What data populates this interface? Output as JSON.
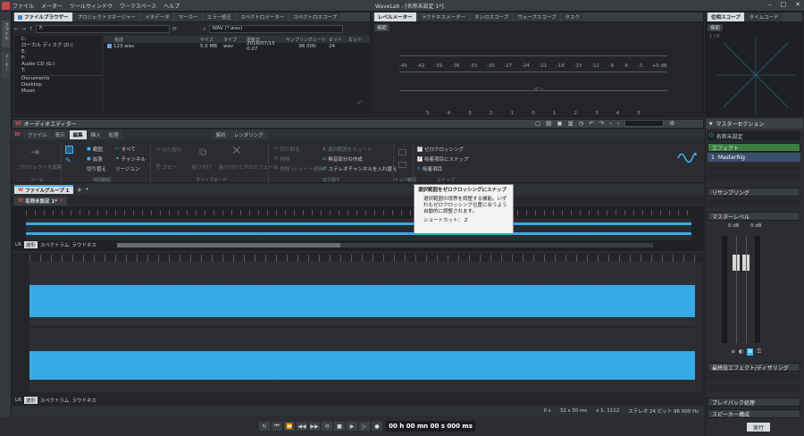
{
  "window": {
    "title": "WaveLab - [名称未設定 1*]"
  },
  "menu": [
    "ファイル",
    "メーター",
    "ツールウィンドウ",
    "ワークスペース",
    "ヘルプ"
  ],
  "left_strip": [
    "ファイル",
    "メーター"
  ],
  "upper_tabs": [
    "ファイルブラウザー",
    "プロジェクトマネージャー",
    "メタデータ",
    "マーカー",
    "エラー修正",
    "スペクトロメーター",
    "スペクトロスコープ"
  ],
  "browser": {
    "path": "F:",
    "filter": "WAV (*.wav)",
    "tree": [
      "C:",
      "ローカル ディスク (D:)",
      "E:",
      "F:",
      "Audio CD (G:)",
      "T:",
      "Documents",
      "Desktop",
      "Music"
    ],
    "columns": [
      "名前",
      "サイズ",
      "タイプ",
      "更新日",
      "サンプリングレート",
      "ビット",
      "ビット"
    ],
    "files": [
      {
        "name": "123.wav",
        "size": "5.0 MB",
        "type": "wav",
        "date": "2016/07/15 0:27",
        "rate": "96 000",
        "bits": "24"
      }
    ]
  },
  "meter_tabs": [
    "レベルメーター",
    "ラウドネスメーター",
    "オシロスコープ",
    "ウェーブスコープ",
    "タスク"
  ],
  "meter": {
    "mode": "模範",
    "scale": [
      "-45",
      "-42",
      "-39",
      "-36",
      "-33",
      "-30",
      "-27",
      "-24",
      "-21",
      "-18",
      "-15",
      "-12",
      "-9",
      "-6",
      "-3",
      "+0 dB"
    ],
    "pan_label": "パン",
    "pan_scale": [
      "5",
      "4",
      "3",
      "2",
      "1",
      "0",
      "1",
      "2",
      "3",
      "4",
      "5"
    ]
  },
  "phase_tabs": [
    "位相スコープ",
    "タイムコード"
  ],
  "phase": {
    "mode": "模範",
    "top_left": "1 / 0"
  },
  "audio_editor": {
    "title": "オーディオエディター",
    "tabs": [
      "ファイル",
      "表示",
      "編集",
      "挿入",
      "処理",
      "解析",
      "レンダリング"
    ],
    "active_tab": "編集"
  },
  "ribbon": {
    "sections": [
      "ツール",
      "時間範囲",
      "クリップボード",
      "切り取り",
      "ナッジ範囲",
      "スナップ"
    ],
    "tool_item": "プロジェクトを編集",
    "time_range": [
      "範囲",
      "すべて",
      "拡張",
      "チャンネル",
      "切り替え",
      "リージョン"
    ],
    "clipboard": [
      "切り取り",
      "コピー",
      "貼り付け",
      "貼り付けとクロスフェード"
    ],
    "cut_items": [
      "切り取る",
      "削除",
      "削除 (シュート適用)",
      "選択範囲をミュート",
      "無音部分の作成",
      "ステレオチャンネルを入れ替え"
    ],
    "snap_items": [
      "ゼロクロッシング",
      "吸着項目にスナップ",
      "吸着項目"
    ]
  },
  "tooltip": {
    "title": "選択範囲をゼロクロッシングにスナップ",
    "body": "選択範囲の境界を調整する機能。いずれもゼロクロッシング位置に合うよう自動的に調整されます。",
    "shortcut": "ショートカット： Z"
  },
  "file_group": {
    "label": "ファイルグループ 1",
    "doc": "名称未設定 1*"
  },
  "view_tabs": [
    "波形",
    "スペクトラム",
    "ラウドネス"
  ],
  "status": {
    "time": "0 s",
    "zoom": "32 s 30 ms",
    "ratio": "x 1: 1112",
    "format": "ステレオ 24 ビット 96 000 Hz"
  },
  "transport": {
    "time": "00 h 00 mn 00 s 000 ms"
  },
  "master": {
    "title": "マスターセクション",
    "preset": "名称未設定",
    "effects_label": "エフェクト",
    "effect_slot": "MasterRig",
    "resampling": "リサンプリング",
    "master_level": "マスターレベル",
    "level_left": "0 dB",
    "level_right": "0 dB",
    "final_effects": "最終段エフェクト/ディザリング",
    "playback": "プレイバック処理",
    "speaker": "スピーカー構成",
    "render": "実行"
  }
}
